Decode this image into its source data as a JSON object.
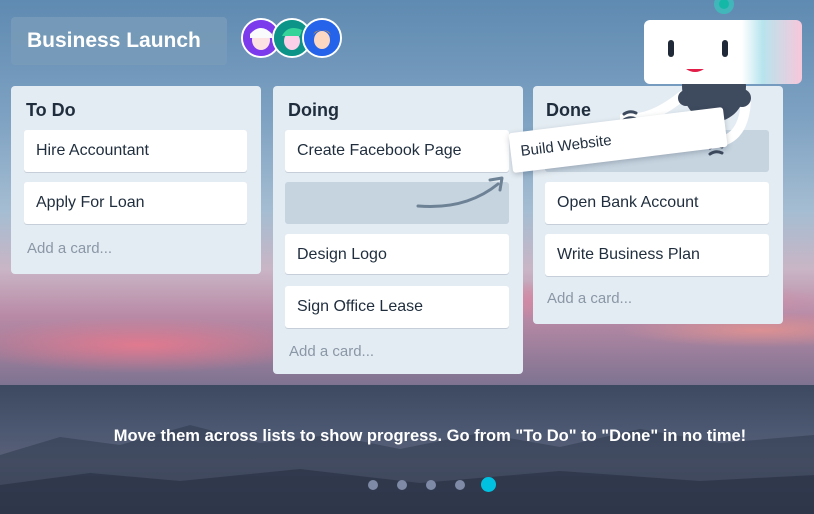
{
  "board": {
    "title": "Business Launch",
    "members": [
      "member-1",
      "member-2",
      "member-3"
    ]
  },
  "lists": [
    {
      "title": "To Do",
      "cards": [
        "Hire Accountant",
        "Apply For Loan"
      ],
      "add_card": "Add a card..."
    },
    {
      "title": "Doing",
      "cards": [
        "Create Facebook Page",
        "Design Logo",
        "Sign Office Lease"
      ],
      "add_card": "Add a card..."
    },
    {
      "title": "Done",
      "cards": [
        "Open Bank Account",
        "Write Business Plan"
      ],
      "add_card": "Add a card..."
    }
  ],
  "dragging_card": "Build Website",
  "caption": "Move them across lists to show progress. Go from \"To Do\" to \"Done\" in no time!",
  "pagination": {
    "total": 5,
    "active": 5
  },
  "colors": {
    "accent": "#00c2e0",
    "list_bg": "#e4ecf3",
    "title_bg": "#789bb9"
  }
}
